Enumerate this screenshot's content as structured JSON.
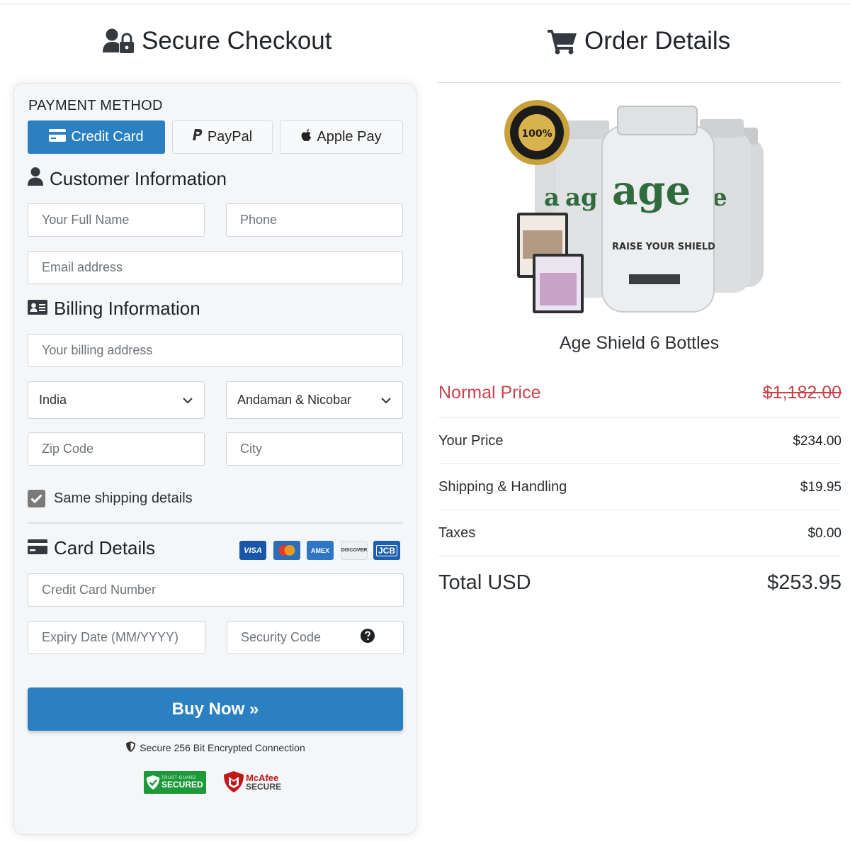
{
  "checkout": {
    "title": "Secure Checkout",
    "payment_method_label": "PAYMENT METHOD",
    "tabs": [
      {
        "label": "Credit Card",
        "icon": "credit-card-icon",
        "active": true
      },
      {
        "label": "PayPal",
        "icon": "paypal-icon",
        "active": false
      },
      {
        "label": "Apple Pay",
        "icon": "apple-icon",
        "active": false
      }
    ],
    "customer_section": "Customer Information",
    "full_name_placeholder": "Your Full Name",
    "phone_placeholder": "Phone",
    "email_placeholder": "Email address",
    "billing_section": "Billing Information",
    "billing_address_placeholder": "Your billing address",
    "country_value": "India",
    "state_value": "Andaman & Nicobar",
    "zip_placeholder": "Zip Code",
    "city_placeholder": "City",
    "same_shipping_label": "Same shipping details",
    "same_shipping_checked": true,
    "card_section": "Card Details",
    "card_brands": [
      "VISA",
      "mastercard",
      "AMEX",
      "DISCOVER",
      "JCB"
    ],
    "card_number_placeholder": "Credit Card Number",
    "expiry_placeholder": "Expiry Date (MM/YYYY)",
    "security_code_placeholder": "Security Code",
    "buy_button": "Buy Now »",
    "secure_note": "Secure 256 Bit Encrypted Connection",
    "badges": {
      "trust_guard_top": "TRUST GUARD",
      "trust_guard_main": "SECURED",
      "mcafee_top": "McAfee",
      "mcafee_bottom": "SECURE"
    }
  },
  "order": {
    "title": "Order Details",
    "product_name": "Age Shield 6 Bottles",
    "product_art": {
      "seal_text": "100%",
      "brand": "age",
      "tagline": "RAISE YOUR SHIELD"
    },
    "normal_price_label": "Normal Price",
    "normal_price_value": "$1,182.00",
    "your_price_label": "Your Price",
    "your_price_value": "$234.00",
    "shipping_label": "Shipping & Handling",
    "shipping_value": "$19.95",
    "taxes_label": "Taxes",
    "taxes_value": "$0.00",
    "total_label": "Total USD",
    "total_value": "$253.95"
  },
  "colors": {
    "accent": "#2a80c0",
    "strike_red": "#c7444f",
    "card_bg": "#f5f6f8"
  }
}
